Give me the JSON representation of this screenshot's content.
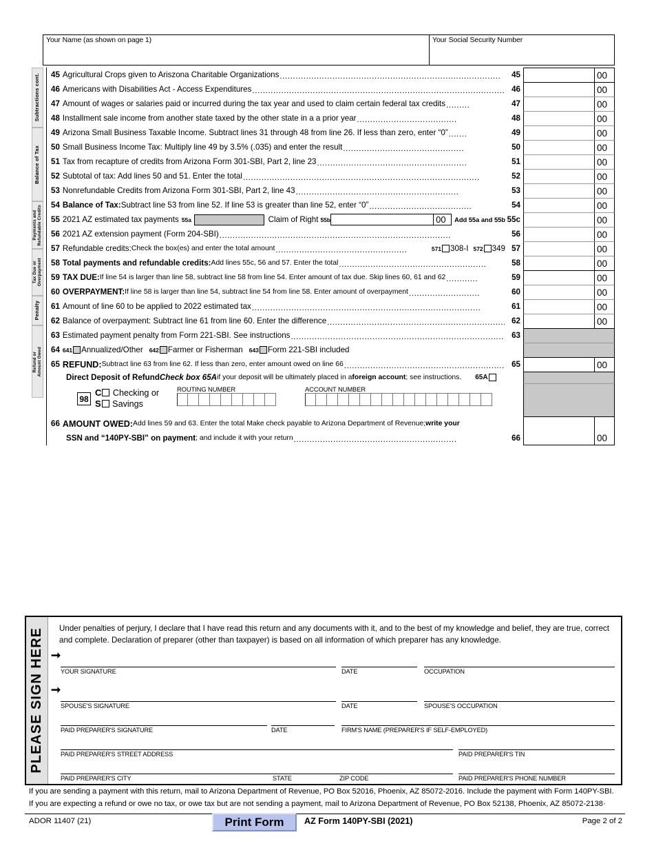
{
  "header": {
    "name_label": "Your Name (as shown on page 1)",
    "ssn_label": "Your Social Security Number"
  },
  "rails": [
    {
      "id": "subtractions",
      "label": "Subtractions cont."
    },
    {
      "id": "balance-of-tax",
      "label": "Balance of Tax"
    },
    {
      "id": "payments-refundable-credits",
      "label": "Payments and\nRefundable Credits"
    },
    {
      "id": "tax-due-overpayment",
      "label": "Tax Due or\nOverpayment"
    },
    {
      "id": "penalty",
      "label": "Penalty"
    },
    {
      "id": "refund-amount-owed",
      "label": "Refund or\nAmount Owed"
    }
  ],
  "lines": [
    {
      "no": "45",
      "text": "Agricultural Crops given to Ariszona Charitable Organizations",
      "right": "45",
      "cents": "00"
    },
    {
      "no": "46",
      "text": "Americans with Disabilities Act - Access Expenditures",
      "right": "46",
      "cents": "00"
    },
    {
      "no": "47",
      "text": "Amount of wages or salaries paid or incurred during the tax year and used to claim certain federal tax credits",
      "right": "47",
      "cents": "00"
    },
    {
      "no": "48",
      "text": "Installment sale income from another state taxed by the other state in a a prior year",
      "right": "48",
      "cents": "00"
    },
    {
      "no": "49",
      "text": "Arizona Small Business Taxable Income.  Subtract lines 31 through 48 from line 26.  If less than zero, enter “0”",
      "right": "49",
      "cents": "00"
    },
    {
      "no": "50",
      "text": "Small Business Income Tax:  Multiply line 49 by 3.5% (.035) and enter the result",
      "right": "50",
      "cents": "00"
    },
    {
      "no": "51",
      "text": "Tax from recapture of credits from Arizona Form 301-SBI, Part 2, line 23",
      "right": "51",
      "cents": "00"
    },
    {
      "no": "52",
      "text": "Subtotal of tax:  Add lines 50 and 51.  Enter the total",
      "right": "52",
      "cents": "00"
    },
    {
      "no": "53",
      "text": "Nonrefundable Credits from Arizona Form 301-SBI, Part 2, line 43",
      "right": "53",
      "cents": "00"
    },
    {
      "no": "54",
      "bold_lead": "Balance of Tax:",
      "text": "  Subtract line 53 from line 52.  If line 53 is greater than line 52, enter “0”",
      "right": "54",
      "cents": "00"
    },
    {
      "no": "56",
      "text": "2021 AZ extension payment (Form 204-SBI)",
      "right": "56",
      "cents": "00"
    },
    {
      "no": "58",
      "bold_lead": "Total payments and refundable credits:",
      "text": "  Add lines 55c, 56 and 57.  Enter the total",
      "right": "58",
      "cents": "00"
    },
    {
      "no": "59",
      "bold_lead": "TAX DUE:",
      "text": "  If line 54 is larger than line 58, subtract line 58 from line 54.  Enter amount of tax due. Skip lines 60, 61 and 62",
      "right": "59",
      "cents": "00"
    },
    {
      "no": "60",
      "bold_lead": "OVERPAYMENT:",
      "text": "  If line 58 is larger than line 54, subtract line 54 from line 58.  Enter amount of overpayment",
      "right": "60",
      "cents": "00"
    },
    {
      "no": "61",
      "text": "Amount of line 60 to be applied to 2022 estimated tax",
      "right": "61",
      "cents": "00"
    },
    {
      "no": "62",
      "text": "Balance of overpayment:  Subtract line 61 from line 60.  Enter the difference ",
      "right": "62",
      "cents": "00"
    },
    {
      "no": "63",
      "text": "Estimated payment penalty from Form 221-SBI.  See instructions",
      "right": "63",
      "cents": ""
    }
  ],
  "line55": {
    "no": "55",
    "text": "2021 AZ estimated tax payments",
    "sub_a": "55a",
    "claim_label": "Claim of Right",
    "sub_b": "55b",
    "cents_inline": "00",
    "add_note": "Add 55a and 55b",
    "right": "55c",
    "cents": "00"
  },
  "line57": {
    "no": "57",
    "lead": "Refundable credits:",
    "text": "  Check the box(es) and enter the total amount ",
    "box1_num": "571",
    "box1_label": "308-I",
    "box2_num": "572",
    "box2_label": "349",
    "right": "57",
    "cents": "00"
  },
  "line64": {
    "no": "64",
    "box1_num": "641",
    "box1_label": "Annualized/Other",
    "box2_num": "642",
    "box2_label": "Farmer or Fisherman",
    "box3_num": "643",
    "box3_label": "Form 221-SBI included"
  },
  "line65": {
    "no": "65",
    "lead": "REFUND:",
    "text": "  Subtract line 63 from line 62.  If less than zero, enter amount owed on line 66 ",
    "right": "65",
    "cents": "00",
    "dd_lead": "Direct Deposit of Refund",
    "dd_italic": "Check box 65A",
    "dd_text1": " if your deposit will be ultimately placed in a ",
    "dd_bold": "foreign account",
    "dd_text2": "; see instructions.",
    "dd_box_label": "65A",
    "code98": "98",
    "checking_letter": "C",
    "checking_label": "Checking or",
    "savings_letter": "S",
    "savings_label": "Savings",
    "routing_caption": "ROUTING NUMBER",
    "routing_cells": 9,
    "account_caption": "ACCOUNT NUMBER",
    "account_cells": 17
  },
  "line66": {
    "no": "66",
    "lead": "AMOUNT OWED:",
    "text1": "  Add lines 59 and 63.  Enter the total    Make check payable to Arizona Department of Revenue; ",
    "bold1": "write your",
    "bold2": "SSN and “140PY-SBI” on payment",
    "text2": "; and include it with your return",
    "right": "66",
    "cents": "00"
  },
  "signature": {
    "rail_label": "PLEASE SIGN HERE",
    "perjury": "Under penalties of perjury, I declare that I have read this return and any documents with it, and to the best of my knowledge and belief, they are true, correct and complete.  Declaration of preparer (other than taxpayer) is based on all information of which preparer has any knowledge.",
    "your_signature": "YOUR SIGNATURE",
    "date1": "DATE",
    "occupation": "OCCUPATION",
    "spouse_signature": "SPOUSE'S SIGNATURE",
    "date2": "DATE",
    "spouse_occupation": "SPOUSE'S OCCUPATION",
    "preparer_signature": "PAID PREPARER'S SIGNATURE",
    "date3": "DATE",
    "firm_name": "FIRM'S NAME (PREPARER'S IF SELF-EMPLOYED)",
    "preparer_address": "PAID PREPARER'S STREET ADDRESS",
    "preparer_tin": "PAID PREPARER'S TIN",
    "preparer_city": "PAID PREPARER'S CITY",
    "state": "STATE",
    "zip": "ZIP CODE",
    "preparer_phone": "PAID PREPARER'S PHONE NUMBER"
  },
  "footer": {
    "note1": "If you are sending a payment with this return, mail to Arizona Department of Revenue, PO Box 52016, Phoenix, AZ  85072-2016.  Include the payment with Form 140PY-SBI.",
    "note2": "If you are expecting a refund or owe no tax, or owe tax but are not sending a payment, mail to Arizona Department of Revenue, PO Box 52138, Phoenix, AZ  85072-2138·",
    "ador": "ADOR 11407 (21)",
    "print_button": "Print Form",
    "form_name": "AZ Form 140PY-SBI (2021)",
    "page": "Page 2 of 2"
  },
  "colors": {
    "rail_bg": "#e9e9e9",
    "shade": "#c8c8c8",
    "print_button_bg": "#b6c4ee"
  }
}
